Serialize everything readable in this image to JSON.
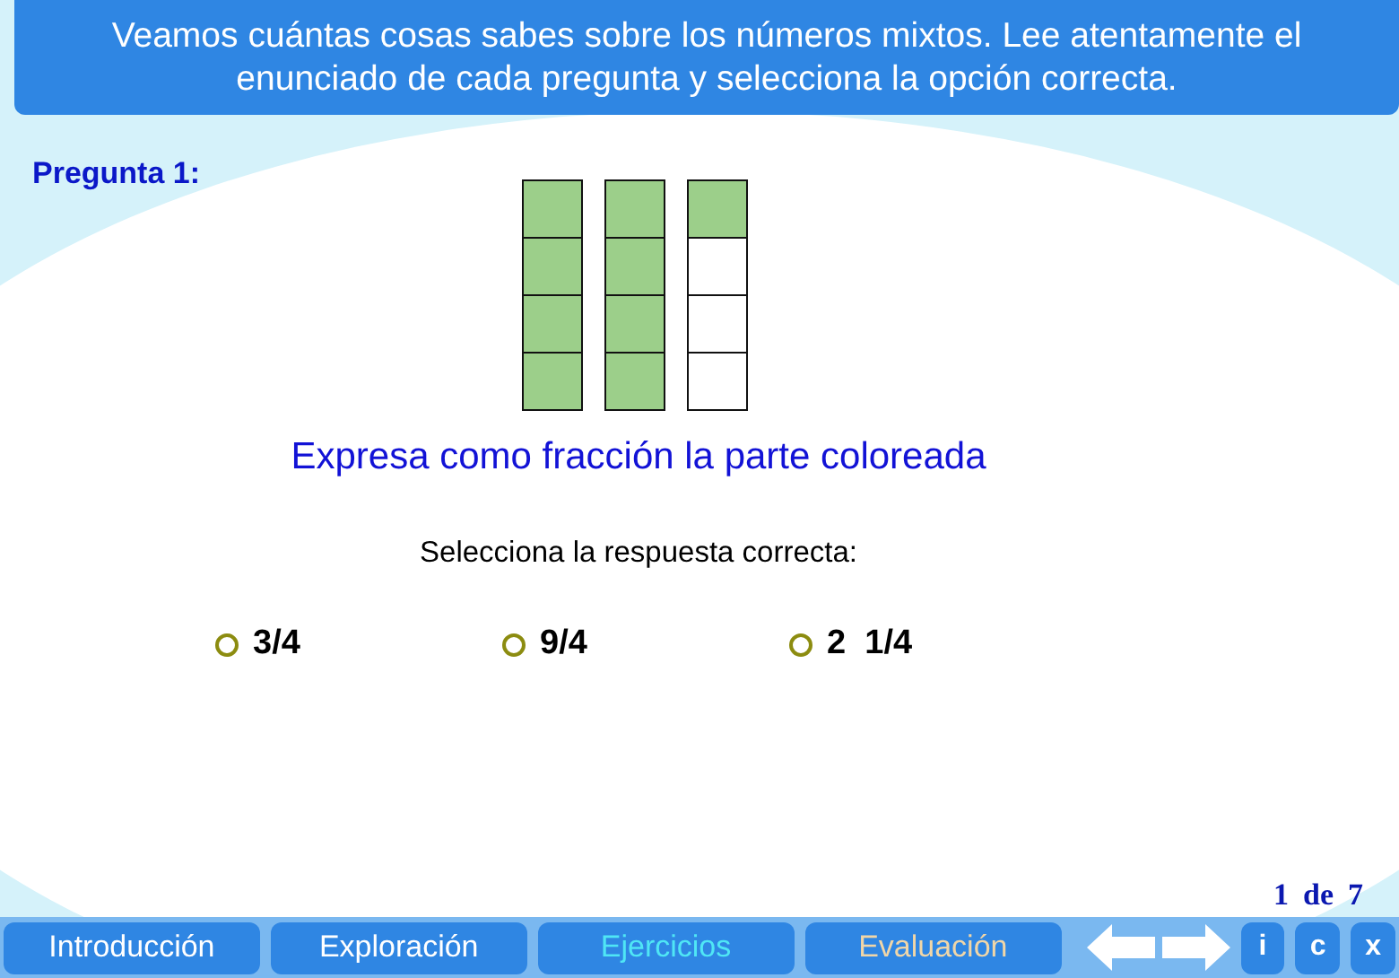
{
  "header": {
    "text": "Veamos cuántas cosas sabes sobre los números mixtos. Lee atentamente el enunciado de cada pregunta y selecciona la opción correcta."
  },
  "question": {
    "label": "Pregunta 1:",
    "prompt": "Expresa como fracción la parte coloreada",
    "instruction": "Selecciona la respuesta correcta:",
    "figure": [
      {
        "cells": [
          {
            "filled": true
          },
          {
            "filled": true
          },
          {
            "filled": true
          },
          {
            "filled": true
          }
        ]
      },
      {
        "cells": [
          {
            "filled": true
          },
          {
            "filled": true
          },
          {
            "filled": true
          },
          {
            "filled": true
          }
        ]
      },
      {
        "cells": [
          {
            "filled": true
          },
          {
            "filled": false
          },
          {
            "filled": false
          },
          {
            "filled": false
          }
        ]
      }
    ],
    "options": [
      {
        "label": "3/4",
        "selected": false
      },
      {
        "label": "9/4",
        "selected": false
      },
      {
        "label": "2  1/4",
        "selected": false
      }
    ]
  },
  "page_counter": {
    "current": "1",
    "separator": "de",
    "total": "7"
  },
  "tabs": [
    {
      "label": "Introducción",
      "selected": false,
      "disabled": false
    },
    {
      "label": "Exploración",
      "selected": false,
      "disabled": false
    },
    {
      "label": "Ejercicios",
      "selected": true,
      "disabled": false
    },
    {
      "label": "Evaluación",
      "selected": false,
      "disabled": true
    }
  ],
  "small_buttons": [
    "i",
    "c",
    "x"
  ]
}
